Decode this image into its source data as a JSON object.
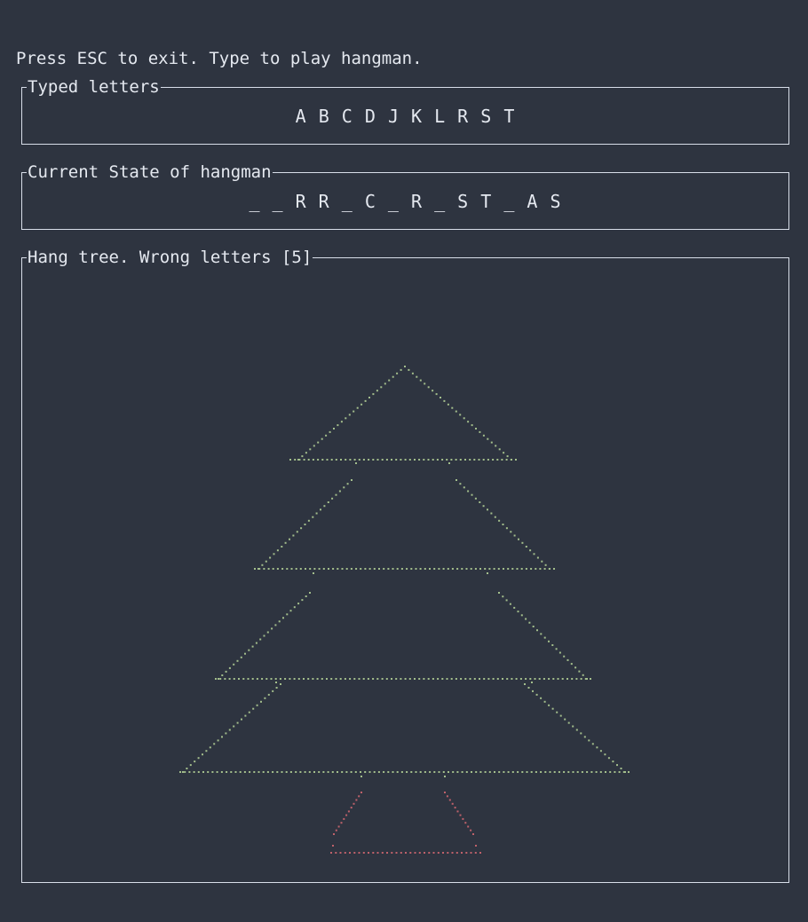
{
  "instructions": "Press ESC to exit. Type to play hangman.",
  "typed_panel": {
    "title": "Typed letters",
    "letters": "A B C D J K L R S T"
  },
  "state_panel": {
    "title": "Current State of hangman",
    "state": "_ _ R R _ C _ R _ S T _ A S"
  },
  "tree_panel": {
    "title": "Hang tree. Wrong letters [5]",
    "wrong_count": 5,
    "tree_color": "#a3be8c",
    "trunk_color": "#bf616a"
  },
  "colors": {
    "background": "#2e3440",
    "foreground": "#e5e9f0",
    "border": "#d8dee9"
  }
}
